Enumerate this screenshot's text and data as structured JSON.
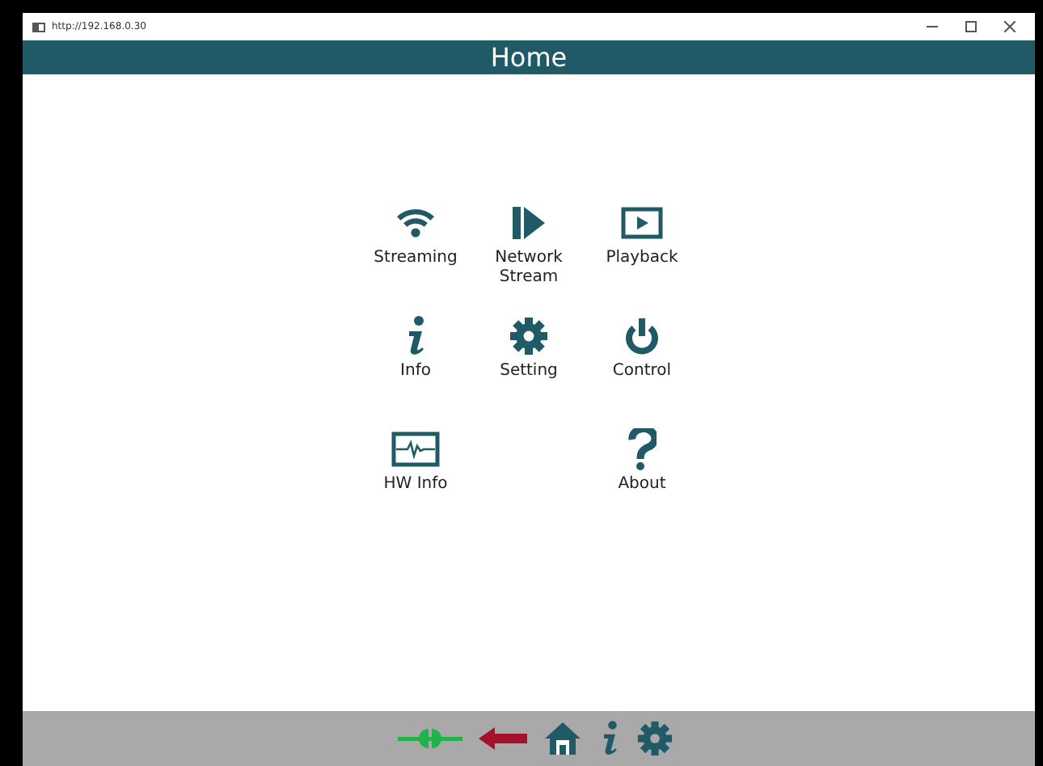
{
  "window": {
    "url": "http://192.168.0.30"
  },
  "header": {
    "title": "Home"
  },
  "rows": [
    {
      "items": [
        {
          "kind": "wifi",
          "label": "Streaming"
        },
        {
          "kind": "stream",
          "label": "Network Stream"
        },
        {
          "kind": "play",
          "label": "Playback"
        }
      ]
    },
    {
      "items": [
        {
          "kind": "info",
          "label": "Info"
        },
        {
          "kind": "gear",
          "label": "Setting"
        },
        {
          "kind": "power",
          "label": "Control"
        }
      ]
    },
    {
      "items": [
        {
          "kind": "monitor",
          "label": "HW Info"
        },
        {
          "kind": "question",
          "label": "About"
        }
      ]
    }
  ],
  "footer": [
    {
      "kind": "plug"
    },
    {
      "kind": "back"
    },
    {
      "kind": "home"
    },
    {
      "kind": "info"
    },
    {
      "kind": "gear"
    }
  ]
}
